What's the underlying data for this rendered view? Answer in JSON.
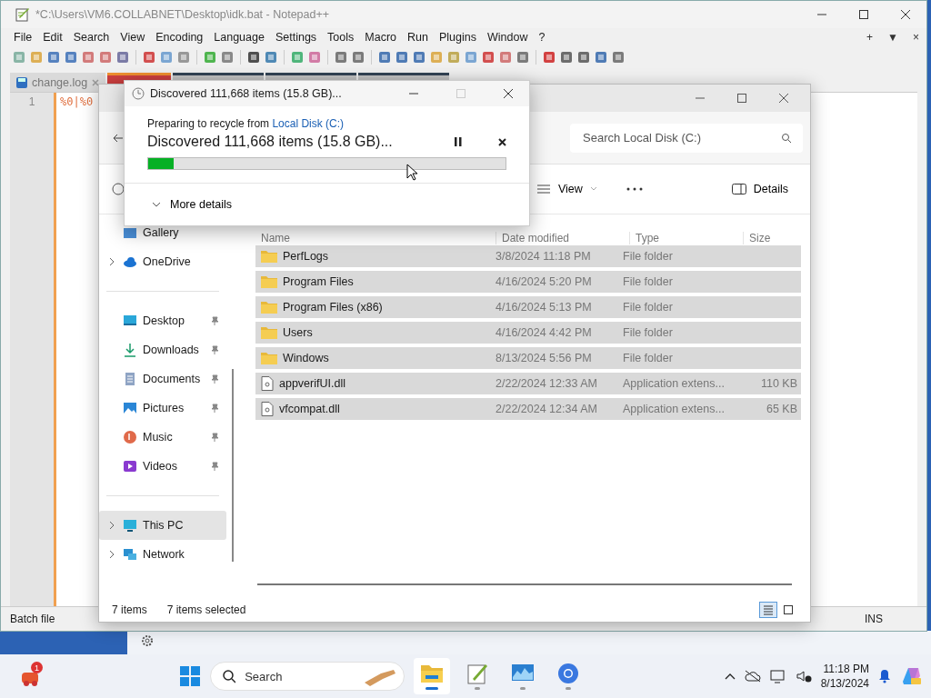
{
  "notepad": {
    "title": "*C:\\Users\\VM6.COLLABNET\\Desktop\\idk.bat - Notepad++",
    "menu": [
      "File",
      "Edit",
      "Search",
      "View",
      "Encoding",
      "Language",
      "Settings",
      "Tools",
      "Macro",
      "Run",
      "Plugins",
      "Window",
      "?"
    ],
    "menu_controls": [
      "+",
      "▼",
      "×"
    ],
    "tabs": [
      {
        "label": "change.log",
        "selected": false
      }
    ],
    "line_numbers": [
      "1"
    ],
    "editor_text": "%0|%0",
    "status_bar": {
      "file_type": "Batch file",
      "mode": "INS"
    }
  },
  "explorer": {
    "search": {
      "placeholder": "Search Local Disk (C:)"
    },
    "commands": [
      {
        "label": "View",
        "kind": "view"
      },
      {
        "label": "Details",
        "kind": "details"
      }
    ],
    "sidebar": [
      [
        {
          "label": "Gallery",
          "kind": "gallery",
          "pinned": false,
          "expandable": false,
          "selected": false
        },
        {
          "label": "OneDrive",
          "kind": "cloud",
          "pinned": false,
          "expandable": true,
          "selected": false
        }
      ],
      [
        {
          "label": "Desktop",
          "kind": "desktop",
          "pinned": true,
          "expandable": false,
          "selected": false
        },
        {
          "label": "Downloads",
          "kind": "downloads",
          "pinned": true,
          "expandable": false,
          "selected": false
        },
        {
          "label": "Documents",
          "kind": "documents",
          "pinned": true,
          "expandable": false,
          "selected": false
        },
        {
          "label": "Pictures",
          "kind": "pictures",
          "pinned": true,
          "expandable": false,
          "selected": false
        },
        {
          "label": "Music",
          "kind": "music",
          "pinned": true,
          "expandable": false,
          "selected": false
        },
        {
          "label": "Videos",
          "kind": "videos",
          "pinned": true,
          "expandable": false,
          "selected": false
        }
      ],
      [
        {
          "label": "This PC",
          "kind": "pc",
          "pinned": false,
          "expandable": true,
          "selected": true
        },
        {
          "label": "Network",
          "kind": "network",
          "pinned": false,
          "expandable": true,
          "selected": false
        }
      ]
    ],
    "columns": [
      "Name",
      "Date modified",
      "Type",
      "Size"
    ],
    "rows": [
      {
        "name": "PerfLogs",
        "kind": "folder",
        "date": "3/8/2024 11:18 PM",
        "type": "File folder",
        "size": "",
        "selected": true
      },
      {
        "name": "Program Files",
        "kind": "folder",
        "date": "4/16/2024 5:20 PM",
        "type": "File folder",
        "size": "",
        "selected": true
      },
      {
        "name": "Program Files (x86)",
        "kind": "folder",
        "date": "4/16/2024 5:13 PM",
        "type": "File folder",
        "size": "",
        "selected": true
      },
      {
        "name": "Users",
        "kind": "folder",
        "date": "4/16/2024 4:42 PM",
        "type": "File folder",
        "size": "",
        "selected": true
      },
      {
        "name": "Windows",
        "kind": "folder",
        "date": "8/13/2024 5:56 PM",
        "type": "File folder",
        "size": "",
        "selected": true
      },
      {
        "name": "appverifUI.dll",
        "kind": "file",
        "date": "2/22/2024 12:33 AM",
        "type": "Application extens...",
        "size": "110 KB",
        "selected": true
      },
      {
        "name": "vfcompat.dll",
        "kind": "file",
        "date": "2/22/2024 12:34 AM",
        "type": "Application extens...",
        "size": "65 KB",
        "selected": true
      }
    ],
    "status": {
      "count": "7 items",
      "selection": "7 items selected"
    },
    "layouts": [
      {
        "kind": "details",
        "selected": true
      },
      {
        "kind": "tiles",
        "selected": false
      }
    ]
  },
  "dialog": {
    "title": "Discovered 111,668 items (15.8 GB)...",
    "subtitle": "Preparing to recycle from ",
    "location": "Local Disk (C:)",
    "message": "Discovered 111,668 items (15.8 GB)...",
    "level": 0.07,
    "details": "More details"
  },
  "taskbar": {
    "badge": "1",
    "search": {
      "placeholder": "Search"
    },
    "apps": [
      {
        "kind": "explorer",
        "active": true
      },
      {
        "kind": "notepad",
        "active": false
      },
      {
        "kind": "monitor",
        "active": false
      },
      {
        "kind": "browser",
        "active": false
      }
    ],
    "time": "11:18 PM",
    "date": "8/13/2024"
  }
}
